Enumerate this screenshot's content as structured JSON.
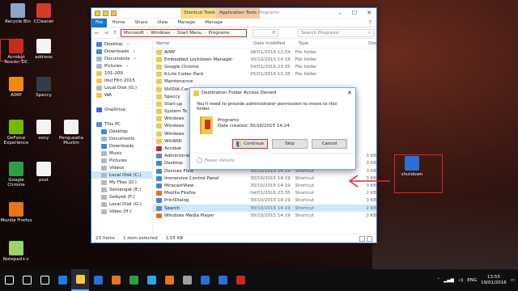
{
  "desktop": {
    "icons": [
      {
        "label": "Recycle Bin",
        "icon": "recycle-bin-icon",
        "color": "#8aa6c8"
      },
      {
        "label": "CCleaner",
        "icon": "ccleaner-icon",
        "color": "#d23b2b"
      },
      {
        "label": "Acrobat Reader DC",
        "icon": "acrobat-icon",
        "color": "#c62a1e"
      },
      {
        "label": "address",
        "icon": "text-file-icon",
        "color": "#f4f4f4"
      },
      {
        "label": "AIMP",
        "icon": "aimp-icon",
        "color": "#f08a12"
      },
      {
        "label": "Speccy",
        "icon": "speccy-icon",
        "color": "#333c48"
      },
      {
        "label": "GeForce Experience",
        "icon": "geforce-icon",
        "color": "#76b900"
      },
      {
        "label": "sony",
        "icon": "text-file-icon",
        "color": "#f4f4f4"
      },
      {
        "label": "Pengusaha Muslim",
        "icon": "text-file-icon",
        "color": "#f4f4f4"
      },
      {
        "label": "Google Chrome",
        "icon": "chrome-icon",
        "color": "#2f9e44"
      },
      {
        "label": "post",
        "icon": "text-file-icon",
        "color": "#f4f4f4"
      },
      {
        "label": "Mozilla Firefox",
        "icon": "firefox-icon",
        "color": "#e8741c"
      },
      {
        "label": "Notepad++",
        "icon": "notepadpp-icon",
        "color": "#9ad46b"
      },
      {
        "label": "shutdown",
        "icon": "shutdown-icon",
        "color": "#2c6fd6"
      }
    ]
  },
  "explorer": {
    "title": "Programs",
    "contextual_tabs": {
      "shortcut": "Shortcut Tools",
      "application": "Application Tools"
    },
    "ribbon_tabs": {
      "file": "File",
      "home": "Home",
      "share": "Share",
      "view": "View",
      "manage1": "Manage",
      "manage2": "Manage"
    },
    "breadcrumb": [
      "Microsoft",
      "Windows",
      "Start Menu",
      "Programs"
    ],
    "search_placeholder": "Search Programs",
    "columns": {
      "name": "Name",
      "date": "Date modified",
      "type": "Type",
      "size": "Size"
    },
    "nav": [
      {
        "label": "Desktop",
        "pinned": true,
        "color": "#3f86d8"
      },
      {
        "label": "Downloads",
        "pinned": true,
        "color": "#3f86d8"
      },
      {
        "label": "Documents",
        "pinned": true,
        "color": "#a9b7c7"
      },
      {
        "label": "Pictures",
        "pinned": true,
        "color": "#a9b7c7"
      },
      {
        "label": "101-200",
        "pinned": false,
        "color": "#f3c94c"
      },
      {
        "label": "Idul Fitri 2015",
        "pinned": false,
        "color": "#f3c94c"
      },
      {
        "label": "Local Disk (G:)",
        "pinned": false,
        "color": "#b7b7b7"
      },
      {
        "label": "WA",
        "pinned": false,
        "color": "#f3c94c"
      },
      {
        "label": "",
        "pinned": false,
        "color": ""
      },
      {
        "label": "OneDrive",
        "pinned": false,
        "color": "#2c6fd6"
      },
      {
        "label": "",
        "pinned": false,
        "color": ""
      },
      {
        "label": "This PC",
        "pinned": false,
        "color": "#4a8fd8"
      },
      {
        "label": "Desktop",
        "pinned": false,
        "color": "#3f86d8"
      },
      {
        "label": "Documents",
        "pinned": false,
        "color": "#a9b7c7"
      },
      {
        "label": "Downloads",
        "pinned": false,
        "color": "#3f86d8"
      },
      {
        "label": "Music",
        "pinned": false,
        "color": "#a9b7c7"
      },
      {
        "label": "Pictures",
        "pinned": false,
        "color": "#a9b7c7"
      },
      {
        "label": "Videos",
        "pinned": false,
        "color": "#a9b7c7"
      },
      {
        "label": "Local Disk (C:)",
        "pinned": false,
        "color": "#b7b7b7",
        "selected": true
      },
      {
        "label": "My Files (D:)",
        "pinned": false,
        "color": "#b7b7b7"
      },
      {
        "label": "Semangat (E:)",
        "pinned": false,
        "color": "#b7b7b7"
      },
      {
        "label": "Gebyek (F:)",
        "pinned": false,
        "color": "#b7b7b7"
      },
      {
        "label": "Local Disk (G:)",
        "pinned": false,
        "color": "#b7b7b7"
      },
      {
        "label": "Video (H:)",
        "pinned": false,
        "color": "#b7b7b7"
      }
    ],
    "files": [
      {
        "name": "AIMP",
        "date": "08/01/2016 12:54",
        "type": "File folder",
        "size": "",
        "folder": true
      },
      {
        "name": "Embedded Lockdown Manager",
        "date": "30/10/2015 14:24",
        "type": "File folder",
        "size": "",
        "folder": true
      },
      {
        "name": "Google Chrome",
        "date": "04/01/2016 23:35",
        "type": "File folder",
        "size": "",
        "folder": true
      },
      {
        "name": "K-Lite Codec Pack",
        "date": "05/01/2016 13:38",
        "type": "File folder",
        "size": "",
        "folder": true
      },
      {
        "name": "Maintenance",
        "date": "",
        "type": "",
        "size": "",
        "folder": true
      },
      {
        "name": "NVIDIA Cor",
        "date": "",
        "type": "",
        "size": "",
        "folder": true
      },
      {
        "name": "Speccy",
        "date": "",
        "type": "",
        "size": "",
        "folder": true
      },
      {
        "name": "Start-up",
        "date": "",
        "type": "",
        "size": "",
        "folder": true
      },
      {
        "name": "System To",
        "date": "",
        "type": "",
        "size": "",
        "folder": true
      },
      {
        "name": "Windows",
        "date": "",
        "type": "",
        "size": "",
        "folder": true
      },
      {
        "name": "Windows",
        "date": "",
        "type": "",
        "size": "",
        "folder": true
      },
      {
        "name": "Windows",
        "date": "",
        "type": "",
        "size": "",
        "folder": true
      },
      {
        "name": "WinRAR",
        "date": "",
        "type": "",
        "size": "",
        "folder": true
      },
      {
        "name": "Acrobat",
        "date": "",
        "type": "",
        "size": "",
        "folder": false,
        "color": "#c62a1e"
      },
      {
        "name": "Administrative Tools",
        "date": "30/10/2015 14:19",
        "type": "Shortcut",
        "size": "3 KB",
        "folder": false,
        "color": "#6d86a6"
      },
      {
        "name": "Desktop",
        "date": "30/10/2015 14:19",
        "type": "Shortcut",
        "size": "3 KB",
        "folder": false,
        "color": "#3f86d8"
      },
      {
        "name": "Devices Flow",
        "date": "30/10/2015 14:19",
        "type": "Shortcut",
        "size": "3 KB",
        "folder": false,
        "color": "#3f86d8"
      },
      {
        "name": "Immersive Control Panel",
        "date": "30/10/2015 14:19",
        "type": "Shortcut",
        "size": "3 KB",
        "folder": false,
        "color": "#3f86d8"
      },
      {
        "name": "MiracastView",
        "date": "30/10/2015 14:19",
        "type": "Shortcut",
        "size": "3 KB",
        "folder": false,
        "color": "#3f86d8"
      },
      {
        "name": "Mozilla Firefox",
        "date": "04/01/2016 23:35",
        "type": "Shortcut",
        "size": "2 KB",
        "folder": false,
        "color": "#e8741c"
      },
      {
        "name": "PrintDialog",
        "date": "30/10/2015 14:19",
        "type": "Shortcut",
        "size": "3 KB",
        "folder": false,
        "color": "#3f86d8"
      },
      {
        "name": "Search",
        "date": "30/10/2015 14:19",
        "type": "Shortcut",
        "size": "2 KB",
        "folder": false,
        "color": "#6d86a6",
        "selected": true
      },
      {
        "name": "Windows Media Player",
        "date": "30/10/2015 14:19",
        "type": "Shortcut",
        "size": "2 KB",
        "folder": false,
        "color": "#e8741c"
      }
    ],
    "status": {
      "items": "23 items",
      "selected": "1 item selected",
      "size": "1.55 KB"
    }
  },
  "dialog": {
    "title": "Destination Folder Access Denied",
    "message": "You'll need to provide administrator permission to move to this folder",
    "item_name": "Programs",
    "item_date": "Date created: 30/10/2015 14:24",
    "continue_label": "Continue",
    "skip_label": "Skip",
    "cancel_label": "Cancel",
    "fewer_details": "Fewer details"
  },
  "taskbar": {
    "apps": [
      {
        "icon": "start-windows-icon",
        "color": "#ffffff"
      },
      {
        "icon": "search-icon",
        "color": "#ffffff"
      },
      {
        "icon": "task-view-icon",
        "color": "#ffffff"
      },
      {
        "icon": "edge-icon",
        "color": "#1e7be0"
      },
      {
        "icon": "file-explorer-icon",
        "color": "#f3c94c",
        "active": true
      },
      {
        "icon": "store-icon",
        "color": "#2c6fd6"
      },
      {
        "icon": "firefox-icon",
        "color": "#e8741c"
      },
      {
        "icon": "chrome-icon",
        "color": "#2f9e44"
      },
      {
        "icon": "ie-icon",
        "color": "#3aa0e6"
      },
      {
        "icon": "media-player-icon",
        "color": "#e8741c"
      },
      {
        "icon": "settings-icon",
        "color": "#a0a0a0"
      },
      {
        "icon": "photos-icon",
        "color": "#2c6fd6"
      },
      {
        "icon": "mail-icon",
        "color": "#2c6fd6"
      },
      {
        "icon": "acrobat-icon",
        "color": "#c62a1e"
      }
    ],
    "language": "ENG",
    "time": "13:55",
    "date": "19/01/2016"
  }
}
